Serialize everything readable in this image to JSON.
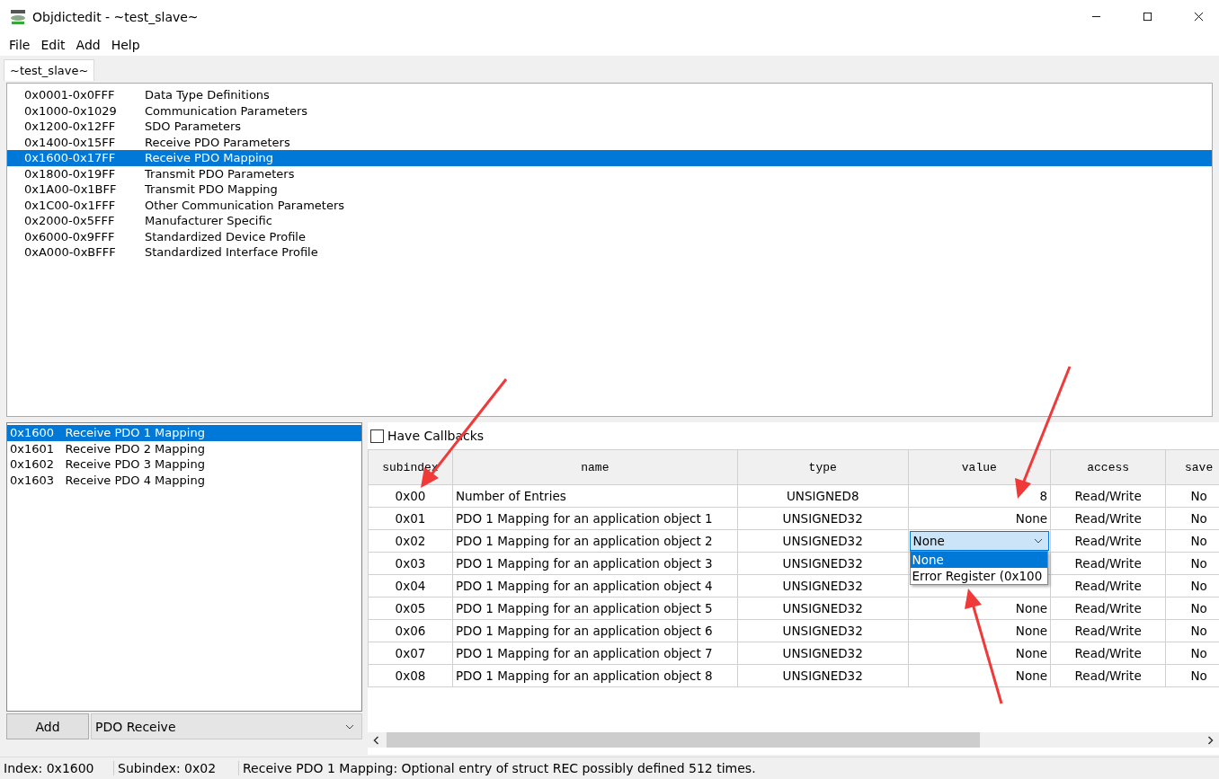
{
  "window": {
    "title": "Objdictedit - ~test_slave~"
  },
  "menu": [
    "File",
    "Edit",
    "Add",
    "Help"
  ],
  "tabs": [
    {
      "label": "~test_slave~",
      "selected": true
    }
  ],
  "ranges": [
    {
      "range": "0x0001-0x0FFF",
      "name": "Data Type Definitions",
      "selected": false
    },
    {
      "range": "0x1000-0x1029",
      "name": "Communication Parameters",
      "selected": false
    },
    {
      "range": "0x1200-0x12FF",
      "name": "SDO Parameters",
      "selected": false
    },
    {
      "range": "0x1400-0x15FF",
      "name": "Receive PDO Parameters",
      "selected": false
    },
    {
      "range": "0x1600-0x17FF",
      "name": "Receive PDO Mapping",
      "selected": true
    },
    {
      "range": "0x1800-0x19FF",
      "name": "Transmit PDO Parameters",
      "selected": false
    },
    {
      "range": "0x1A00-0x1BFF",
      "name": "Transmit PDO Mapping",
      "selected": false
    },
    {
      "range": "0x1C00-0x1FFF",
      "name": "Other Communication Parameters",
      "selected": false
    },
    {
      "range": "0x2000-0x5FFF",
      "name": "Manufacturer Specific",
      "selected": false
    },
    {
      "range": "0x6000-0x9FFF",
      "name": "Standardized Device Profile",
      "selected": false
    },
    {
      "range": "0xA000-0xBFFF",
      "name": "Standardized Interface Profile",
      "selected": false
    }
  ],
  "indexes": [
    {
      "index": "0x1600",
      "name": "Receive PDO 1 Mapping",
      "selected": true
    },
    {
      "index": "0x1601",
      "name": "Receive PDO 2 Mapping",
      "selected": false
    },
    {
      "index": "0x1602",
      "name": "Receive PDO 3 Mapping",
      "selected": false
    },
    {
      "index": "0x1603",
      "name": "Receive PDO 4 Mapping",
      "selected": false
    }
  ],
  "add_button": "Add",
  "add_combo": "PDO Receive",
  "have_callbacks": {
    "label": "Have Callbacks",
    "checked": false
  },
  "table": {
    "columns": [
      "subindex",
      "name",
      "type",
      "value",
      "access",
      "save"
    ],
    "rows": [
      {
        "subindex": "0x00",
        "name": "Number of Entries",
        "type": "UNSIGNED8",
        "value": "8",
        "access": "Read/Write",
        "save": "No"
      },
      {
        "subindex": "0x01",
        "name": "PDO 1 Mapping for an application object 1",
        "type": "UNSIGNED32",
        "value": "None",
        "access": "Read/Write",
        "save": "No"
      },
      {
        "subindex": "0x02",
        "name": "PDO 1 Mapping for an application object 2",
        "type": "UNSIGNED32",
        "editor": {
          "value": "None",
          "options": [
            {
              "label": "None",
              "selected": true
            },
            {
              "label": "Error Register (0x100",
              "selected": false
            }
          ]
        },
        "access": "Read/Write",
        "save": "No"
      },
      {
        "subindex": "0x03",
        "name": "PDO 1 Mapping for an application object 3",
        "type": "UNSIGNED32",
        "access": "Read/Write",
        "save": "No"
      },
      {
        "subindex": "0x04",
        "name": "PDO 1 Mapping for an application object 4",
        "type": "UNSIGNED32",
        "access": "Read/Write",
        "save": "No"
      },
      {
        "subindex": "0x05",
        "name": "PDO 1 Mapping for an application object 5",
        "type": "UNSIGNED32",
        "value": "None",
        "access": "Read/Write",
        "save": "No"
      },
      {
        "subindex": "0x06",
        "name": "PDO 1 Mapping for an application object 6",
        "type": "UNSIGNED32",
        "value": "None",
        "access": "Read/Write",
        "save": "No"
      },
      {
        "subindex": "0x07",
        "name": "PDO 1 Mapping for an application object 7",
        "type": "UNSIGNED32",
        "value": "None",
        "access": "Read/Write",
        "save": "No"
      },
      {
        "subindex": "0x08",
        "name": "PDO 1 Mapping for an application object 8",
        "type": "UNSIGNED32",
        "value": "None",
        "access": "Read/Write",
        "save": "No"
      }
    ]
  },
  "status_bar": [
    "Index: 0x1600",
    "Subindex: 0x02",
    "Receive PDO 1 Mapping: Optional entry of struct REC possibly defined 512 times."
  ]
}
